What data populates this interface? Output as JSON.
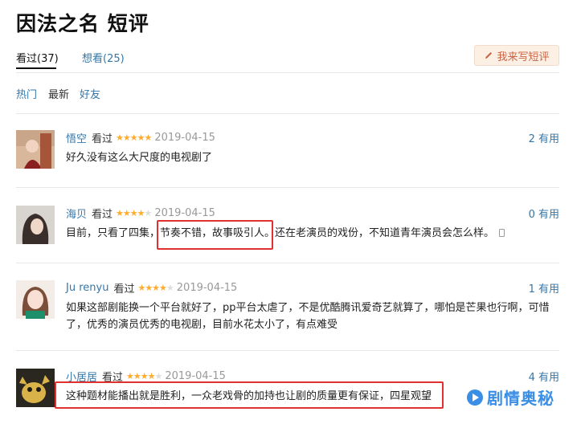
{
  "page": {
    "title": "因法之名 短评"
  },
  "tabs": [
    {
      "label": "看过(37)"
    },
    {
      "label": "想看(25)"
    }
  ],
  "write_button": {
    "label": "我来写短评",
    "icon": "pencil-icon"
  },
  "sort": [
    {
      "label": "热门"
    },
    {
      "label": "最新"
    },
    {
      "label": "好友"
    }
  ],
  "reviews": [
    {
      "user": "悟空",
      "status": "看过",
      "rating": 5,
      "date": "2019-04-15",
      "useful": "2 有用",
      "comment": "好久没有这么大尺度的电视剧了"
    },
    {
      "user": "海贝",
      "status": "看过",
      "rating": 4,
      "date": "2019-04-15",
      "useful": "0 有用",
      "comment": "目前，只看了四集，节奏不错，故事吸引人。还在老演员的戏份，不知道青年演员会怎么样。"
    },
    {
      "user": "Ju renyu",
      "status": "看过",
      "rating": 4,
      "date": "2019-04-15",
      "useful": "1 有用",
      "comment": "如果这部剧能换一个平台就好了，pp平台太虐了，不是优酷腾讯爱奇艺就算了，哪怕是芒果也行啊，可惜了，优秀的演员优秀的电视剧，目前水花太小了，有点难受"
    },
    {
      "user": "小居居",
      "status": "看过",
      "rating": 4,
      "date": "2019-04-15",
      "useful": "4 有用",
      "comment": "这种题材能播出就是胜利，一众老戏骨的加持也让剧的质量更有保证，四星观望"
    }
  ],
  "watermark": {
    "text": "剧情奥秘"
  },
  "colors": {
    "link": "#3377aa",
    "star": "#ffac2d",
    "highlight": "#e03030",
    "watermark": "#3a8ee6"
  }
}
